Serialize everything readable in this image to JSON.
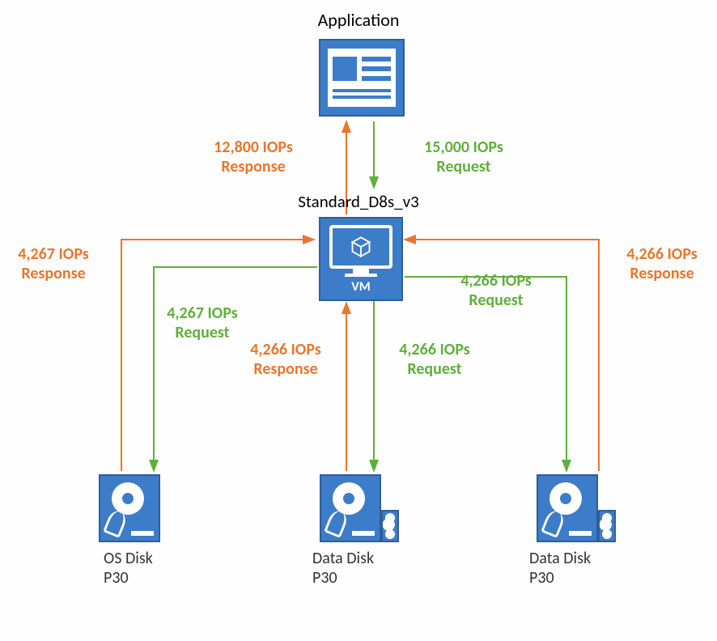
{
  "title": "Application",
  "vm": {
    "label": "VM",
    "sku": "Standard_D8s_v3"
  },
  "disks": [
    {
      "name": "OS Disk",
      "tier": "P30"
    },
    {
      "name": "Data Disk",
      "tier": "P30"
    },
    {
      "name": "Data Disk",
      "tier": "P30"
    }
  ],
  "flows": {
    "app_response": {
      "value": "12,800 IOPs",
      "kind": "Response"
    },
    "app_request": {
      "value": "15,000 IOPs",
      "kind": "Request"
    },
    "os_response": {
      "value": "4,267 IOPs",
      "kind": "Response"
    },
    "os_request": {
      "value": "4,267 IOPs",
      "kind": "Request"
    },
    "d1_response": {
      "value": "4,266 IOPs",
      "kind": "Response"
    },
    "d1_request": {
      "value": "4,266 IOPs",
      "kind": "Request"
    },
    "d2_response": {
      "value": "4,266 IOPs",
      "kind": "Response"
    },
    "d2_request": {
      "value": "4,266 IOPs",
      "kind": "Request"
    }
  },
  "colors": {
    "accent": "#3D7CC9",
    "request": "#5FAF3B",
    "response": "#E8762D"
  }
}
